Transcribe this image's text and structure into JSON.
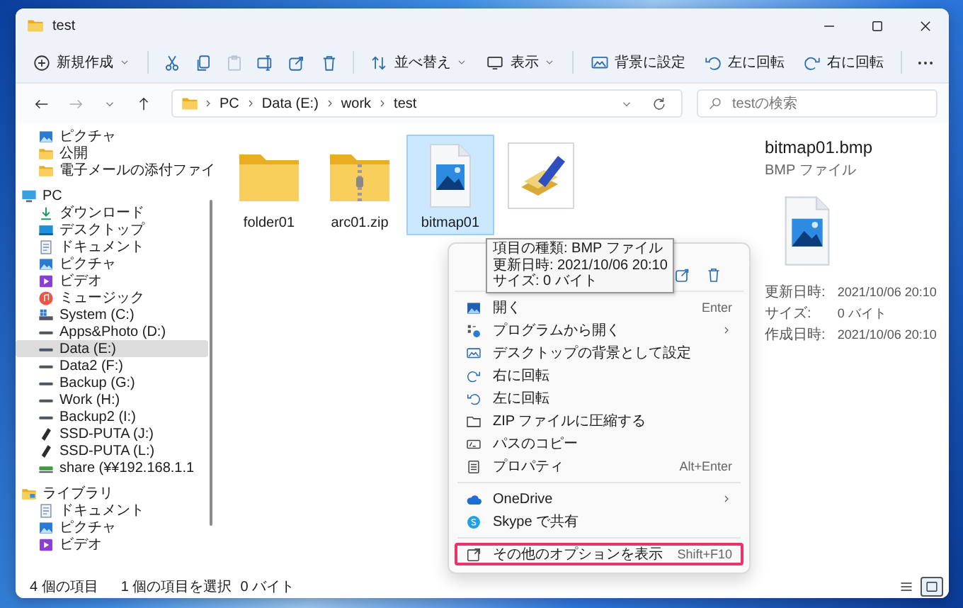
{
  "window": {
    "title": "test"
  },
  "toolbar": [
    {
      "kind": "new",
      "label": "新規作成",
      "dropdown": true,
      "disabled": false
    },
    {
      "kind": "separator"
    },
    {
      "kind": "cut",
      "dropdown": false,
      "disabled": false
    },
    {
      "kind": "copy",
      "dropdown": false,
      "disabled": false
    },
    {
      "kind": "paste",
      "dropdown": false,
      "disabled": true
    },
    {
      "kind": "rename",
      "dropdown": false,
      "disabled": false
    },
    {
      "kind": "share",
      "dropdown": false,
      "disabled": false
    },
    {
      "kind": "delete",
      "dropdown": false,
      "disabled": false
    },
    {
      "kind": "separator"
    },
    {
      "kind": "sort",
      "label": "並べ替え",
      "dropdown": true,
      "disabled": false
    },
    {
      "kind": "view",
      "label": "表示",
      "dropdown": true,
      "disabled": false
    },
    {
      "kind": "separator"
    },
    {
      "kind": "wallpaper",
      "label": "背景に設定",
      "dropdown": false,
      "disabled": false
    },
    {
      "kind": "rotate-left",
      "label": "左に回転",
      "dropdown": false,
      "disabled": false
    },
    {
      "kind": "rotate-right",
      "label": "右に回転",
      "dropdown": false,
      "disabled": false
    },
    {
      "kind": "separator"
    },
    {
      "kind": "more",
      "dropdown": false,
      "disabled": false
    }
  ],
  "address": {
    "path": [
      "PC",
      "Data (E:)",
      "work",
      "test"
    ]
  },
  "search": {
    "placeholder": "testの検索"
  },
  "sidebar": {
    "tree": [
      {
        "children": [
          {
            "label": "ピクチャ",
            "kind": "picture",
            "selected": false
          },
          {
            "label": "公開",
            "kind": "folder",
            "selected": false
          },
          {
            "label": "電子メールの添付ファイ",
            "kind": "folder",
            "selected": false
          }
        ]
      },
      {
        "label": "PC",
        "kind": "pc",
        "selected": false,
        "children": [
          {
            "label": "ダウンロード",
            "kind": "download",
            "selected": false
          },
          {
            "label": "デスクトップ",
            "kind": "desktop",
            "selected": false
          },
          {
            "label": "ドキュメント",
            "kind": "document",
            "selected": false
          },
          {
            "label": "ピクチャ",
            "kind": "picture",
            "selected": false
          },
          {
            "label": "ビデオ",
            "kind": "video",
            "selected": false
          },
          {
            "label": "ミュージック",
            "kind": "music",
            "selected": false
          },
          {
            "label": "System (C:)",
            "kind": "system",
            "selected": false
          },
          {
            "label": "Apps&Photo (D:)",
            "kind": "drive",
            "selected": false
          },
          {
            "label": "Data (E:)",
            "kind": "drive",
            "selected": true
          },
          {
            "label": "Data2 (F:)",
            "kind": "drive",
            "selected": false
          },
          {
            "label": "Backup (G:)",
            "kind": "drive",
            "selected": false
          },
          {
            "label": "Work (H:)",
            "kind": "drive",
            "selected": false
          },
          {
            "label": "Backup2 (I:)",
            "kind": "drive",
            "selected": false
          },
          {
            "label": "SSD-PUTA (J:)",
            "kind": "usb",
            "selected": false
          },
          {
            "label": "SSD-PUTA (L:)",
            "kind": "usb",
            "selected": false
          },
          {
            "label": "share (¥¥192.168.1.1",
            "kind": "network",
            "selected": false
          }
        ]
      },
      {
        "label": "ライブラリ",
        "kind": "library",
        "selected": false,
        "children": [
          {
            "label": "ドキュメント",
            "kind": "document",
            "selected": false
          },
          {
            "label": "ピクチャ",
            "kind": "picture",
            "selected": false
          },
          {
            "label": "ビデオ",
            "kind": "video",
            "selected": false
          }
        ]
      }
    ]
  },
  "files": [
    {
      "name": "folder01",
      "kind": "folder",
      "selected": false
    },
    {
      "name": "arc01.zip",
      "kind": "zip",
      "selected": false
    },
    {
      "name": "bitmap01",
      "kind": "bitmap",
      "selected": true
    },
    {
      "kind": "app",
      "selected": false
    }
  ],
  "tooltip": {
    "lines": [
      "項目の種類: BMP ファイル",
      "更新日時: 2021/10/06 20:10",
      "サイズ: 0 バイト"
    ]
  },
  "context_menu": {
    "items": [
      {
        "kind": "open",
        "label": "開く",
        "shortcut": "Enter",
        "submenu": false,
        "annotated": false
      },
      {
        "kind": "open-with",
        "label": "プログラムから開く",
        "submenu": true,
        "annotated": false
      },
      {
        "kind": "wallpaper",
        "label": "デスクトップの背景として設定",
        "submenu": false,
        "annotated": false
      },
      {
        "kind": "rotate-right",
        "label": "右に回転",
        "submenu": false,
        "annotated": false
      },
      {
        "kind": "rotate-left",
        "label": "左に回転",
        "submenu": false,
        "annotated": false
      },
      {
        "kind": "zip",
        "label": "ZIP ファイルに圧縮する",
        "submenu": false,
        "annotated": false
      },
      {
        "kind": "copy-path",
        "label": "パスのコピー",
        "submenu": false,
        "annotated": false
      },
      {
        "kind": "properties",
        "label": "プロパティ",
        "shortcut": "Alt+Enter",
        "submenu": false,
        "annotated": false
      },
      {
        "kind": "separator"
      },
      {
        "kind": "onedrive",
        "label": "OneDrive",
        "submenu": true,
        "annotated": false
      },
      {
        "kind": "skype",
        "label": "Skype で共有",
        "submenu": false,
        "annotated": false
      },
      {
        "kind": "separator"
      },
      {
        "kind": "more-options",
        "label": "その他のオプションを表示",
        "shortcut": "Shift+F10",
        "submenu": false,
        "annotated": true
      }
    ]
  },
  "details": {
    "title": "bitmap01.bmp",
    "type": "BMP ファイル",
    "properties": [
      {
        "label": "更新日時:",
        "value": "2021/10/06 20:10"
      },
      {
        "label": "サイズ:",
        "value": "0 バイト"
      },
      {
        "label": "作成日時:",
        "value": "2021/10/06 20:10"
      }
    ]
  },
  "status_bar": {
    "item_count": "4 個の項目",
    "selection": "1 個の項目を選択",
    "size": "0 バイト",
    "views": [
      {
        "kind": "details",
        "selected": false
      },
      {
        "kind": "large-icons",
        "selected": true
      }
    ]
  }
}
